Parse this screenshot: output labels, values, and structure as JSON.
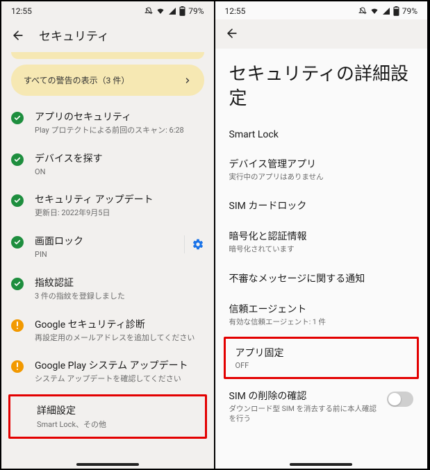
{
  "status": {
    "time": "12:55",
    "battery": "79%"
  },
  "left": {
    "title": "セキュリティ",
    "alert": "すべての警告の表示（3 件）",
    "items": [
      {
        "icon": "check",
        "color": "green",
        "title": "アプリのセキュリティ",
        "subtitle": "Play プロテクトによる前回のスキャン: 6:28"
      },
      {
        "icon": "check",
        "color": "green",
        "title": "デバイスを探す",
        "subtitle": "ON"
      },
      {
        "icon": "check",
        "color": "green",
        "title": "セキュリティ アップデート",
        "subtitle": "更新日: 2022年9月5日"
      },
      {
        "icon": "check",
        "color": "green",
        "title": "画面ロック",
        "subtitle": "PIN",
        "gear": true
      },
      {
        "icon": "check",
        "color": "green",
        "title": "指紋認証",
        "subtitle": "3 件の指紋を登録しました"
      },
      {
        "icon": "warn",
        "color": "amber",
        "title": "Google セキュリティ診断",
        "subtitle": "再設定用のメールアドレスを追加してください"
      },
      {
        "icon": "warn",
        "color": "amber",
        "title": "Google Play システム アップデート",
        "subtitle": "システム アップデートを確認してください"
      }
    ],
    "highlight": {
      "title": "詳細設定",
      "subtitle": "Smart Lock、その他"
    }
  },
  "right": {
    "title": "セキュリティの詳細設定",
    "items": [
      {
        "title": "Smart Lock",
        "subtitle": ""
      },
      {
        "title": "デバイス管理アプリ",
        "subtitle": "実行中のアプリはありません"
      },
      {
        "title": "SIM カードロック",
        "subtitle": ""
      },
      {
        "title": "暗号化と認証情報",
        "subtitle": "暗号化されています"
      },
      {
        "title": "不審なメッセージに関する通知",
        "subtitle": ""
      },
      {
        "title": "信頼エージェント",
        "subtitle": "有効な信頼エージェント: 1 件"
      }
    ],
    "highlight": {
      "title": "アプリ固定",
      "subtitle": "OFF"
    },
    "last": {
      "title": "SIM の削除の確認",
      "subtitle": "ダウンロード型 SIM を消去する前に本人確認を行う"
    }
  }
}
